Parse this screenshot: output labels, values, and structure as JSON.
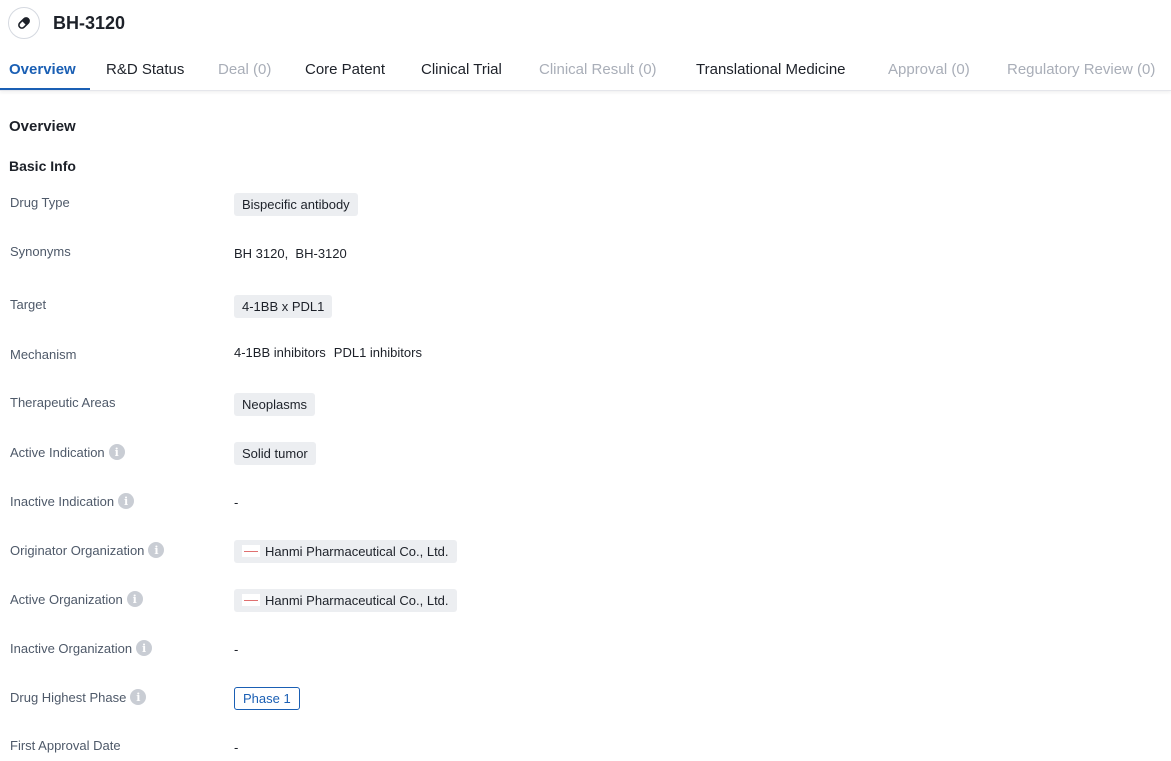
{
  "header": {
    "title": "BH-3120",
    "icon": "pill-icon"
  },
  "tabs": [
    {
      "label": "Overview",
      "state": "active"
    },
    {
      "label": "R&D Status",
      "state": "enabled"
    },
    {
      "label": "Deal (0)",
      "state": "disabled"
    },
    {
      "label": "Core Patent",
      "state": "enabled"
    },
    {
      "label": "Clinical Trial",
      "state": "enabled"
    },
    {
      "label": "Clinical Result (0)",
      "state": "disabled"
    },
    {
      "label": "Translational Medicine",
      "state": "enabled"
    },
    {
      "label": "Approval (0)",
      "state": "disabled"
    },
    {
      "label": "Regulatory Review (0)",
      "state": "disabled"
    }
  ],
  "overview": {
    "title": "Overview",
    "basic_info_title": "Basic Info",
    "fields": {
      "drug_type": {
        "label": "Drug Type",
        "value": "Bispecific antibody"
      },
      "synonyms": {
        "label": "Synonyms",
        "value": "BH 3120,  BH-3120"
      },
      "target": {
        "label": "Target",
        "value": "4-1BB x PDL1"
      },
      "mechanism": {
        "label": "Mechanism",
        "values": [
          "4-1BB inhibitors",
          "PDL1 inhibitors"
        ]
      },
      "therapeutic_areas": {
        "label": "Therapeutic Areas",
        "value": "Neoplasms"
      },
      "active_indication": {
        "label": "Active Indication",
        "value": "Solid tumor"
      },
      "inactive_indication": {
        "label": "Inactive Indication",
        "value": "-"
      },
      "originator_organization": {
        "label": "Originator Organization",
        "value": "Hanmi Pharmaceutical Co., Ltd."
      },
      "active_organization": {
        "label": "Active Organization",
        "value": "Hanmi Pharmaceutical Co., Ltd."
      },
      "inactive_organization": {
        "label": "Inactive Organization",
        "value": "-"
      },
      "drug_highest_phase": {
        "label": "Drug Highest Phase",
        "value": "Phase 1"
      },
      "first_approval_date": {
        "label": "First Approval Date",
        "value": "-"
      }
    }
  },
  "colors": {
    "accent": "#1a5fb4",
    "tag_bg": "#eceef1",
    "disabled_text": "#a9aeb8"
  }
}
